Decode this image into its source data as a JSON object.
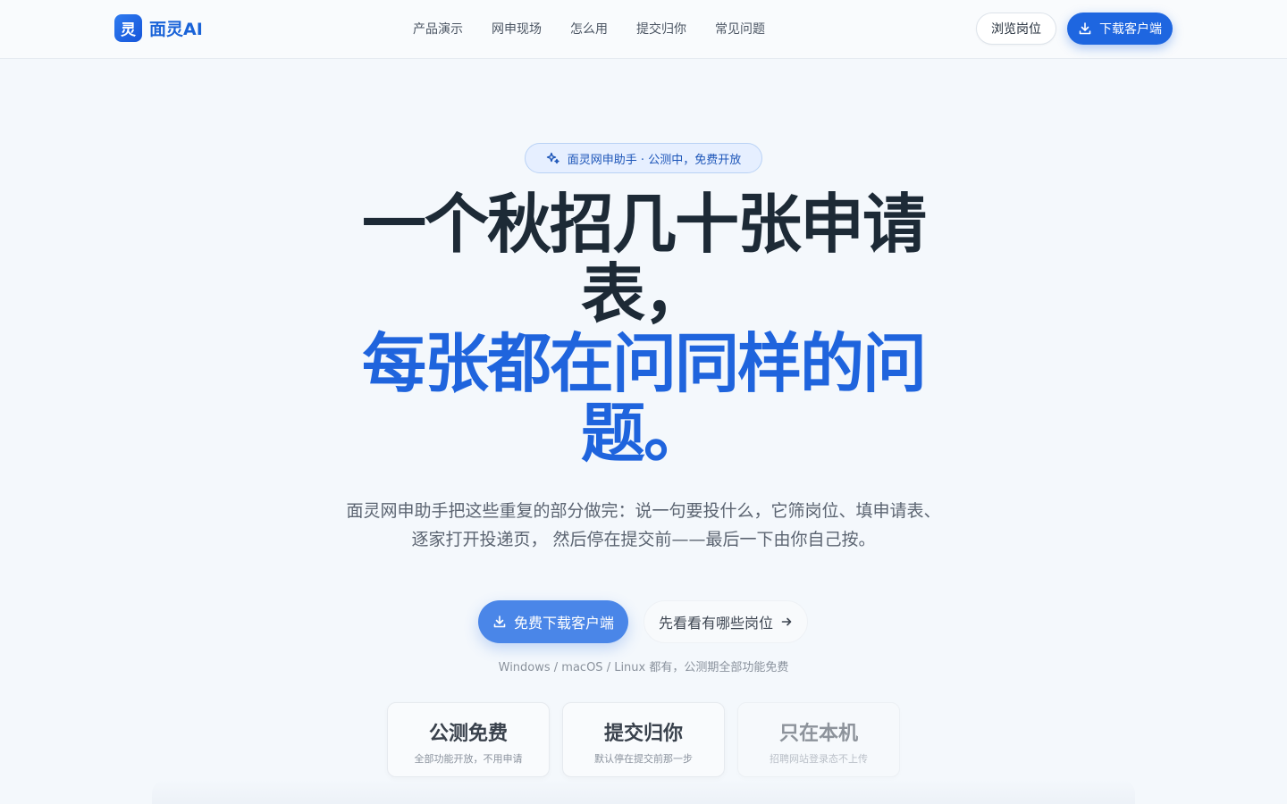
{
  "nav": {
    "brand_logo_text": "灵",
    "brand_name": "面灵AI",
    "links": [
      "产品演示",
      "网申现场",
      "怎么用",
      "提交归你",
      "常见问题"
    ],
    "browse_label": "浏览岗位",
    "download_label": "下载客户端"
  },
  "hero": {
    "badge": "面灵网申助手 · 公测中，免费开放",
    "title_line1": "一个秋招几十张申请表，",
    "title_line2": "每张都在问同样的问题。",
    "subtitle": "面灵网申助手把这些重复的部分做完：说一句要投什么，它筛岗位、填申请表、逐家打开投递页， 然后停在提交前——最后一下由你自己按。",
    "primary_cta": "免费下载客户端",
    "secondary_cta": "先看看有哪些岗位",
    "platform_note": "Windows / macOS / Linux 都有，公测期全部功能免费"
  },
  "features": [
    {
      "title": "公测免费",
      "desc": "全部功能开放，不用申请"
    },
    {
      "title": "提交归你",
      "desc": "默认停在提交前那一步"
    },
    {
      "title": "只在本机",
      "desc": "招聘网站登录态不上传"
    }
  ],
  "colors": {
    "brand": "#1e66e0",
    "primary_cta": "#4a86e8",
    "title_blue": "#1f64dd"
  }
}
